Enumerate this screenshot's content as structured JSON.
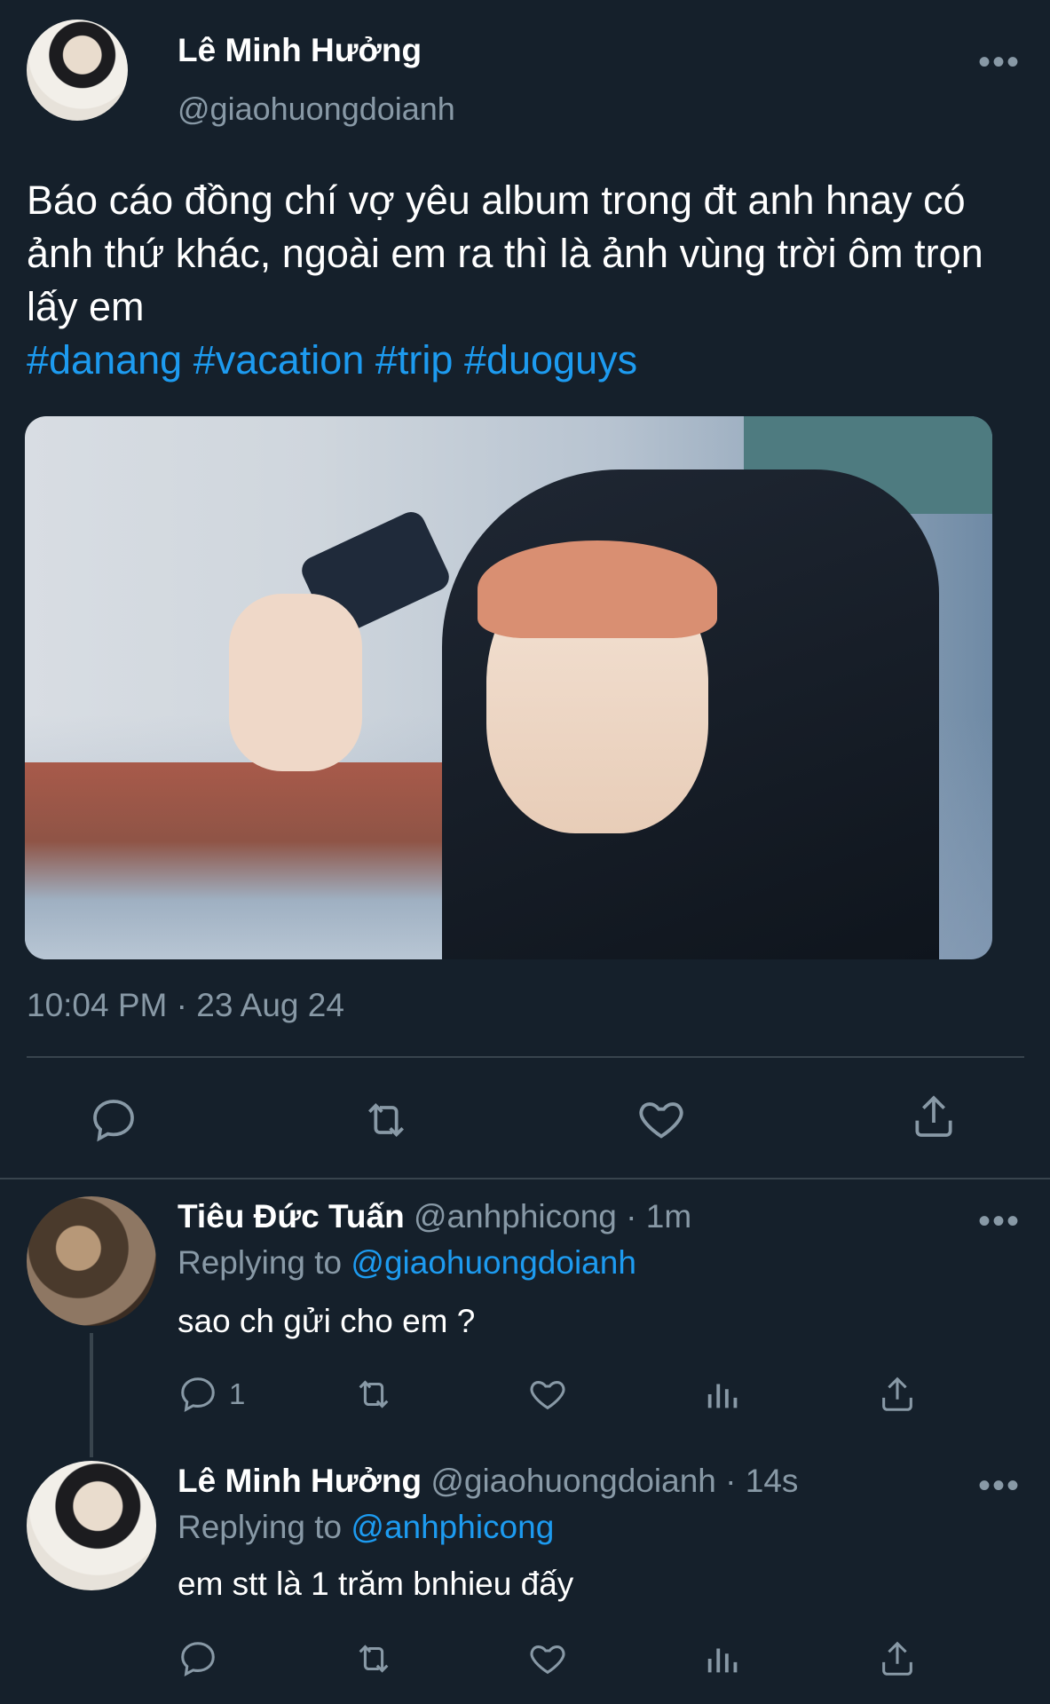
{
  "tweet": {
    "author_name": "Lê Minh Hưởng",
    "author_handle": "@giaohuongdoianh",
    "more_label": "•••",
    "text": "Báo cáo đồng chí vợ yêu album trong đt anh hnay có ảnh thứ khác, ngoài em ra thì là ảnh vùng trời ôm trọn lấy em",
    "hashtags": [
      "#danang",
      "#vacation",
      "#trip",
      "#duoguys"
    ],
    "timestamp": "10:04 PM · 23 Aug 24"
  },
  "replies": [
    {
      "author_name": "Tiêu Đức Tuấn",
      "author_handle": "@anhphicong",
      "time": "· 1m",
      "replying_label": "Replying to",
      "replying_handle": "@giaohuongdoianh",
      "text": "sao ch gửi cho em ?",
      "reply_count": "1"
    },
    {
      "author_name": "Lê Minh Hưởng",
      "author_handle": "@giaohuongdoianh",
      "time": "· 14s",
      "replying_label": "Replying to",
      "replying_handle": "@anhphicong",
      "text": "em stt là 1 trăm bnhieu đấy",
      "reply_count": ""
    }
  ],
  "icons": {
    "reply": "reply-icon",
    "retweet": "retweet-icon",
    "like": "heart-icon",
    "share": "share-icon",
    "analytics": "analytics-icon",
    "more": "more-icon"
  },
  "colors": {
    "background": "#15202b",
    "text": "#ffffff",
    "muted": "#8899a6",
    "link": "#1d9bf0",
    "divider": "#38444d"
  }
}
